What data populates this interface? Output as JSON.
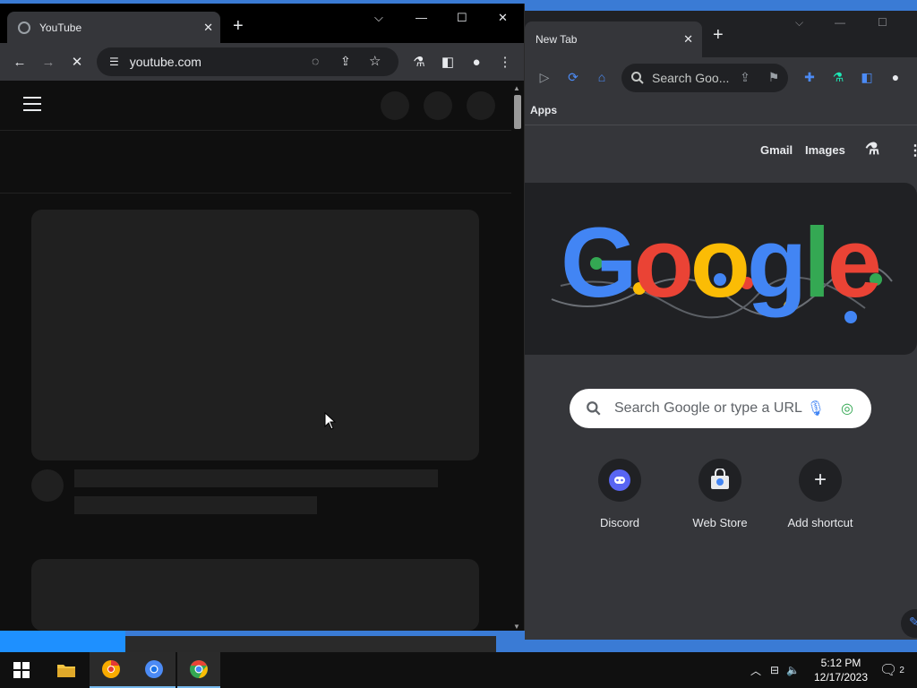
{
  "left_window": {
    "tab_title": "YouTube",
    "url": "youtube.com"
  },
  "right_window": {
    "tab_title": "New Tab",
    "omnibox_placeholder": "Search Goo...",
    "bookmarks_label": "Apps",
    "header_links": {
      "gmail": "Gmail",
      "images": "Images"
    },
    "doodle_text": "Google",
    "search_placeholder": "Search Google or type a URL",
    "shortcuts": [
      {
        "label": "Discord",
        "icon": "discord-icon"
      },
      {
        "label": "Web Store",
        "icon": "web-store-icon"
      },
      {
        "label": "Add shortcut",
        "icon": "plus-icon"
      }
    ]
  },
  "taskbar": {
    "time": "5:12 PM",
    "date": "12/17/2023",
    "notification_count": "2",
    "apps": [
      "file-explorer-icon",
      "chrome-canary-icon",
      "chromium-icon",
      "chrome-icon"
    ]
  },
  "colors": {
    "accent_blue": "#1e90ff",
    "window_dark": "#35363a",
    "youtube_bg": "#0f0f0f"
  }
}
